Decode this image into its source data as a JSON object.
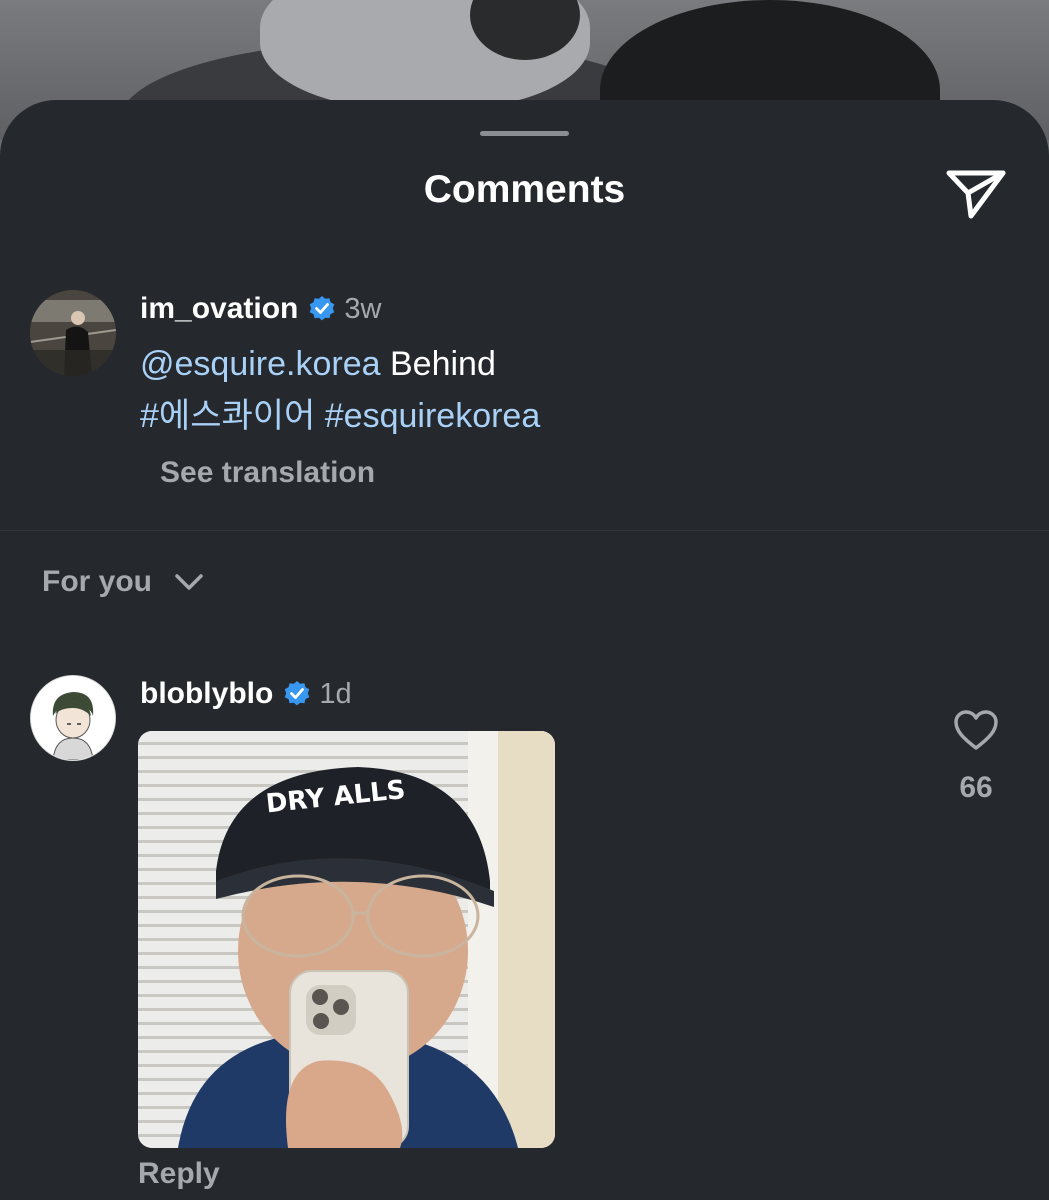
{
  "header": {
    "title": "Comments",
    "share_icon": "paper-plane-icon"
  },
  "caption": {
    "username": "im_ovation",
    "verified": true,
    "time": "3w",
    "mention": "@esquire.korea",
    "text": "Behind",
    "hashtags": [
      "#에스콰이어",
      "#esquirekorea"
    ],
    "see_translation": "See translation"
  },
  "sort": {
    "label": "For you",
    "icon": "chevron-down-icon"
  },
  "comments": [
    {
      "username": "bloblyblo",
      "verified": true,
      "time": "1d",
      "media": "gif",
      "gif_cap_text": "DRY ALLS",
      "likes": "66",
      "reply_label": "Reply"
    }
  ],
  "colors": {
    "background": "#25282c",
    "link": "#a9d1f7",
    "verified": "#3897f0",
    "muted_text": "#a5a8ad"
  }
}
